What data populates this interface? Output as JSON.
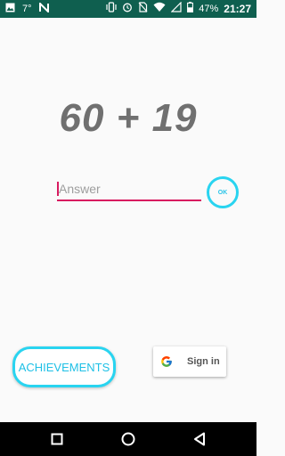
{
  "status_bar": {
    "temperature": "7°",
    "battery": "47%",
    "time": "21:27"
  },
  "expression": "60 + 19",
  "answer": {
    "placeholder": "Answer",
    "value": ""
  },
  "ok_button": {
    "label": "OK"
  },
  "achievements_button": {
    "label": "ACHIEVEMENTS"
  },
  "signin_button": {
    "label": "Sign in"
  },
  "colors": {
    "status_bar": "#0f5f4f",
    "accent_cyan": "#29d4f0",
    "input_underline": "#d81b60",
    "expression_text": "#707070"
  },
  "icons": {
    "status_left": [
      "image-icon",
      "n-logo-icon"
    ],
    "status_right": [
      "vibrate-icon",
      "alarm-icon",
      "no-sim-icon",
      "wifi-icon",
      "no-signal-icon",
      "battery-icon"
    ],
    "nav": [
      "recents-icon",
      "home-icon",
      "back-icon"
    ]
  }
}
